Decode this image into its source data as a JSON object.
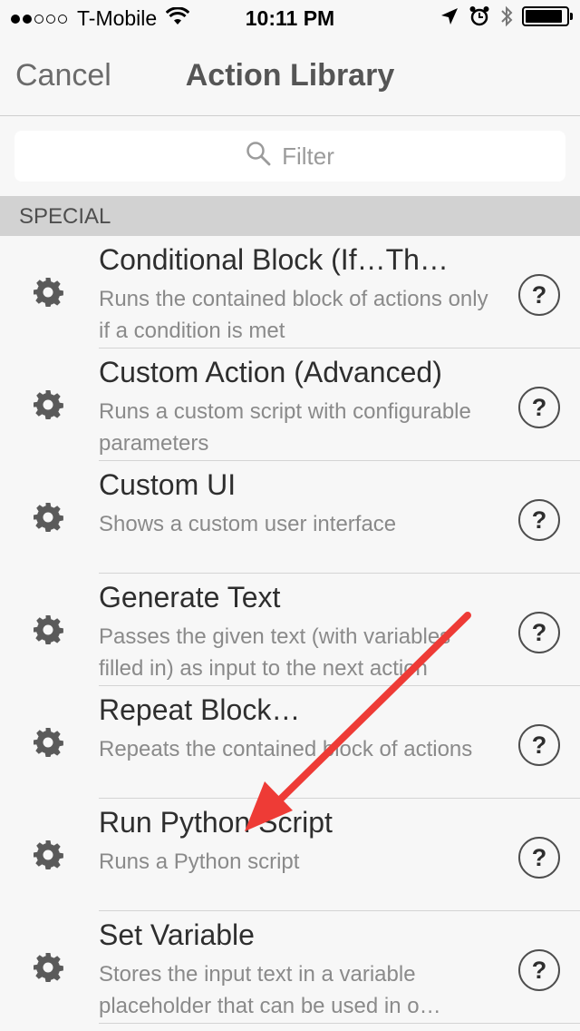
{
  "status_bar": {
    "carrier": "T-Mobile",
    "time": "10:11 PM",
    "signal_bars_filled": 2,
    "signal_bars_total": 5,
    "battery_level": 0.9
  },
  "nav": {
    "cancel_label": "Cancel",
    "title": "Action Library"
  },
  "filter": {
    "placeholder": "Filter"
  },
  "section": {
    "header": "SPECIAL"
  },
  "actions": [
    {
      "title": "Conditional Block (If…Th…",
      "description": "Runs the contained block of actions only if a condition is met",
      "help": "?"
    },
    {
      "title": "Custom Action (Advanced)",
      "description": "Runs a custom script with configurable parameters",
      "help": "?"
    },
    {
      "title": "Custom UI",
      "description": "Shows a custom user interface",
      "help": "?"
    },
    {
      "title": "Generate Text",
      "description": "Passes the given text (with variables filled in) as input to the next action",
      "help": "?"
    },
    {
      "title": "Repeat Block…",
      "description": "Repeats the contained block of actions",
      "help": "?"
    },
    {
      "title": "Run Python Script",
      "description": "Runs a Python script",
      "help": "?"
    },
    {
      "title": "Set Variable",
      "description": "Stores the input text in a variable placeholder that can be used in o…",
      "help": "?"
    }
  ],
  "colors": {
    "annotation_arrow": "#ee3b36",
    "section_background": "#d2d2d2",
    "page_background": "#f7f7f7"
  },
  "icons": {
    "action_icon": "gear-icon",
    "help_icon": "help-icon",
    "filter_icon": "search-icon"
  }
}
